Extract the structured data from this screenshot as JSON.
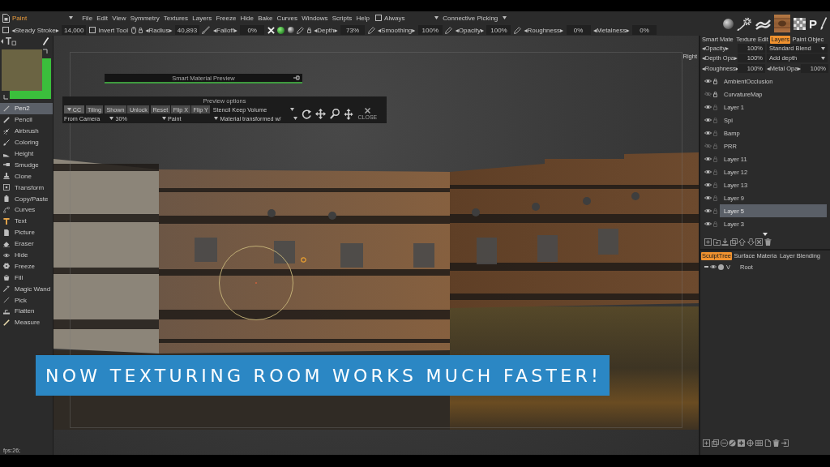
{
  "menubar": {
    "mode": "Paint",
    "menus": [
      "File",
      "Edit",
      "View",
      "Symmetry",
      "Textures",
      "Layers",
      "Freeze",
      "Hide",
      "Bake",
      "Curves",
      "Windows",
      "Scripts",
      "Help"
    ],
    "always": {
      "label": "Always",
      "checked": false
    },
    "picking": "Connective Picking"
  },
  "room_bar": {
    "letter": "P"
  },
  "tool_options": [
    {
      "kind": "param",
      "label": "◂Steady Stroke▸",
      "value": "14,000",
      "checked": false
    },
    {
      "kind": "toggle",
      "label": "Invert Tool",
      "checked": false
    },
    {
      "kind": "param",
      "label": "◂Radius▸",
      "value": "40,893"
    },
    {
      "kind": "param",
      "label": "◂Falloff▸",
      "value": "0%"
    },
    {
      "kind": "param",
      "label": "◂Depth▸",
      "value": "73%"
    },
    {
      "kind": "param",
      "label": "◂Smoothing▸",
      "value": "100%"
    },
    {
      "kind": "param",
      "label": "◂Opacity▸",
      "value": "100%"
    },
    {
      "kind": "param",
      "label": "◂Roughness▸",
      "value": "0%"
    },
    {
      "kind": "param",
      "label": "◂Metalness▸",
      "value": "0%"
    }
  ],
  "color_swatches": [
    {
      "kind": "primary",
      "color": "#6b6443"
    },
    {
      "kind": "secondary",
      "color": "#3bbf3c"
    }
  ],
  "tools": [
    {
      "label": "Pen2",
      "selected": true
    },
    {
      "label": "Pencil",
      "selected": false
    },
    {
      "label": "Airbrush",
      "selected": false
    },
    {
      "label": "Coloring",
      "selected": false
    },
    {
      "label": "Height",
      "selected": false
    },
    {
      "label": "Smudge",
      "selected": false
    },
    {
      "label": "Clone",
      "selected": false
    },
    {
      "label": "Transform",
      "selected": false
    },
    {
      "label": "Copy/Paste",
      "selected": false
    },
    {
      "label": "Curves",
      "selected": false
    },
    {
      "label": "Text",
      "selected": false
    },
    {
      "label": "Picture",
      "selected": false
    },
    {
      "label": "Eraser",
      "selected": false
    },
    {
      "label": "Hide",
      "selected": false
    },
    {
      "label": "Freeze",
      "selected": false
    },
    {
      "label": "Fill",
      "selected": false
    },
    {
      "label": "Magic Wand",
      "selected": false
    },
    {
      "label": "Pick",
      "selected": false
    },
    {
      "label": "Flatten",
      "selected": false
    },
    {
      "label": "Measure",
      "selected": false
    }
  ],
  "fps": "fps:26;",
  "viewport": {
    "view_label": "Right",
    "material_preview": {
      "title": "Smart Material Preview"
    },
    "preview_options": {
      "title": "Preview options",
      "buttons": [
        {
          "kind": "menu",
          "label": "CC"
        },
        {
          "kind": "button",
          "label": "Tiling"
        },
        {
          "kind": "button",
          "label": "Shown"
        },
        {
          "kind": "button",
          "label": "Unlock"
        },
        {
          "kind": "button",
          "label": "Reset"
        },
        {
          "kind": "button",
          "label": "Flip X"
        },
        {
          "kind": "button",
          "label": "Flip Y"
        },
        {
          "kind": "dropdown",
          "label": "Stencil Keep Volume"
        }
      ],
      "dropdowns": [
        "From Camera",
        "30%",
        "Paint",
        "Material transformed w/"
      ],
      "close_label": "CLOSE"
    }
  },
  "banner": "NOW TEXTURING ROOM WORKS MUCH FASTER!",
  "panel_tabs": [
    {
      "label": "Smart Mate",
      "selected": false
    },
    {
      "label": "Texture Edit",
      "selected": false
    },
    {
      "label": "Layers",
      "selected": true
    },
    {
      "label": "Paint Objec",
      "selected": false
    }
  ],
  "layer_props": [
    {
      "kind": "blend",
      "label": "◂Opacity▸",
      "value": "100%",
      "mode": "Standard Blend"
    },
    {
      "kind": "blend",
      "label": "◂Depth Opa▸",
      "value": "100%",
      "mode": "Add depth"
    },
    {
      "kind": "pair",
      "params": [
        {
          "label": "◂Roughness▸",
          "value": "100%"
        },
        {
          "label": "◂Metal Opa▸",
          "value": "100%"
        }
      ]
    }
  ],
  "layers": [
    {
      "name": "AmbientOcclusion",
      "visible": true,
      "locked": true,
      "selected": false
    },
    {
      "name": "CurvatureMap",
      "visible": false,
      "locked": true,
      "selected": false
    },
    {
      "name": "Layer 1",
      "visible": true,
      "locked": false,
      "selected": false
    },
    {
      "name": "Spi",
      "visible": true,
      "locked": false,
      "selected": false
    },
    {
      "name": "Bamp",
      "visible": true,
      "locked": false,
      "selected": false
    },
    {
      "name": "PRR",
      "visible": false,
      "locked": false,
      "selected": false
    },
    {
      "name": "Layer 11",
      "visible": true,
      "locked": false,
      "selected": false
    },
    {
      "name": "Layer 12",
      "visible": true,
      "locked": false,
      "selected": false
    },
    {
      "name": "Layer 13",
      "visible": true,
      "locked": false,
      "selected": false
    },
    {
      "name": "Layer 9",
      "visible": true,
      "locked": false,
      "selected": false
    },
    {
      "name": "Layer 5",
      "visible": true,
      "locked": false,
      "selected": true
    },
    {
      "name": "Layer 3",
      "visible": true,
      "locked": false,
      "selected": false
    }
  ],
  "tree_tabs": [
    {
      "label": "SculptTree",
      "selected": true
    },
    {
      "label": "Surface Materia",
      "selected": false
    },
    {
      "label": "Layer Blending",
      "selected": false
    }
  ],
  "tree": [
    {
      "name": "Root",
      "mode": "V"
    }
  ]
}
